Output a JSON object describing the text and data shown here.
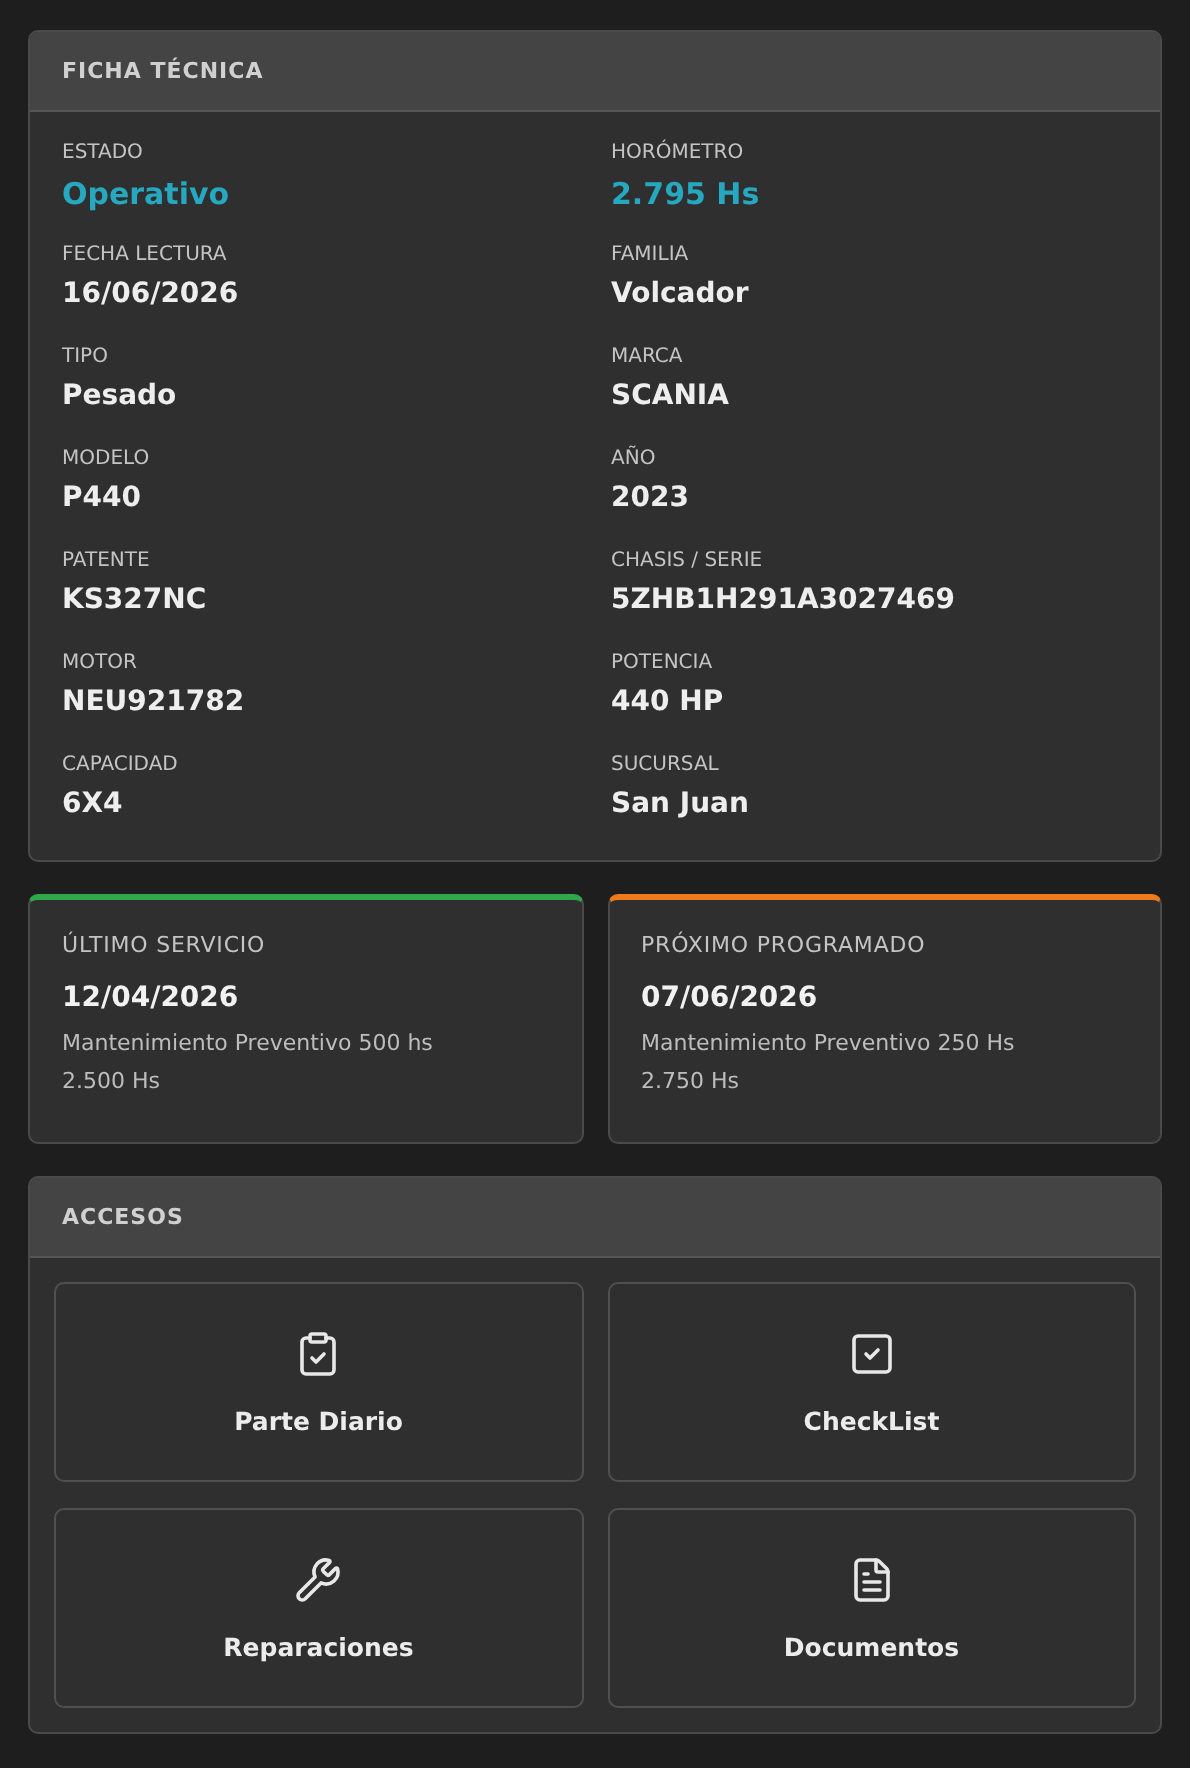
{
  "ficha": {
    "title": "FICHA TÉCNICA",
    "fields": [
      {
        "label": "ESTADO",
        "value": "Operativo",
        "highlighted": true
      },
      {
        "label": "HORÓMETRO",
        "value": "2.795 Hs",
        "highlighted": true
      },
      {
        "label": "FECHA LECTURA",
        "value": "16/06/2026",
        "highlighted": false
      },
      {
        "label": "FAMILIA",
        "value": "Volcador",
        "highlighted": false
      },
      {
        "label": "TIPO",
        "value": "Pesado",
        "highlighted": false
      },
      {
        "label": "MARCA",
        "value": "SCANIA",
        "highlighted": false
      },
      {
        "label": "MODELO",
        "value": "P440",
        "highlighted": false
      },
      {
        "label": "AÑO",
        "value": "2023",
        "highlighted": false
      },
      {
        "label": "PATENTE",
        "value": "KS327NC",
        "highlighted": false
      },
      {
        "label": "CHASIS / SERIE",
        "value": "5ZHB1H291A3027469",
        "highlighted": false
      },
      {
        "label": "MOTOR",
        "value": "NEU921782",
        "highlighted": false
      },
      {
        "label": "POTENCIA",
        "value": "440 HP",
        "highlighted": false
      },
      {
        "label": "CAPACIDAD",
        "value": "6X4",
        "highlighted": false
      },
      {
        "label": "SUCURSAL",
        "value": "San Juan",
        "highlighted": false
      }
    ]
  },
  "services": [
    {
      "title": "ÚLTIMO SERVICIO",
      "date": "12/04/2026",
      "description": "Mantenimiento Preventivo 500 hs",
      "hours": "2.500 Hs",
      "color": "#2ea84a"
    },
    {
      "title": "PRÓXIMO PROGRAMADO",
      "date": "07/06/2026",
      "description": "Mantenimiento Preventivo 250 Hs",
      "hours": "2.750 Hs",
      "color": "#f07a1a"
    }
  ],
  "accesos": {
    "title": "ACCESOS",
    "items": [
      {
        "label": "Parte Diario",
        "kind": "clipboard"
      },
      {
        "label": "CheckList",
        "kind": "checkbox"
      },
      {
        "label": "Reparaciones",
        "kind": "wrench"
      },
      {
        "label": "Documentos",
        "kind": "document"
      }
    ]
  }
}
